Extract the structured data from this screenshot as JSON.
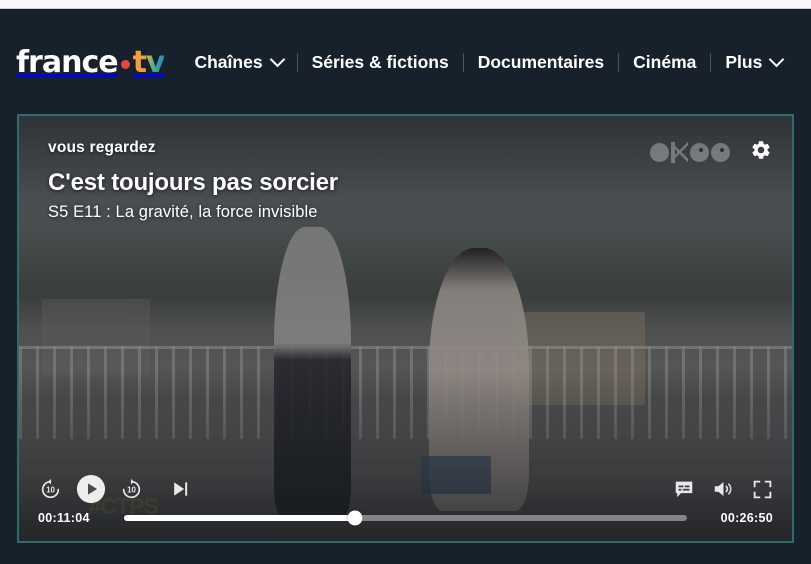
{
  "browser": {
    "bookmarks": [
      "",
      "",
      "",
      "",
      "",
      "",
      "",
      ""
    ]
  },
  "header": {
    "logo": {
      "word": "france",
      "dot_icon": "red-dot",
      "t": "t",
      "v": "v",
      "alt": "france.tv"
    },
    "nav": [
      {
        "label": "Chaînes",
        "has_chevron": true
      },
      {
        "label": "Séries & fictions",
        "has_chevron": false
      },
      {
        "label": "Documentaires",
        "has_chevron": false
      },
      {
        "label": "Cinéma",
        "has_chevron": false
      },
      {
        "label": "Plus",
        "has_chevron": true
      }
    ]
  },
  "player": {
    "kicker": "vous regardez",
    "title": "C'est toujours pas sorcier",
    "episode": "S5 E11 : La gravité, la force invisible",
    "watermark": "okoo",
    "scene_mark": "#CTPS",
    "settings_label": "Paramètres",
    "controls": {
      "rewind_label": "10",
      "play_label": "Lecture",
      "forward_label": "10",
      "next_label": "Épisode suivant",
      "subtitles_label": "Sous-titres",
      "volume_label": "Volume",
      "fullscreen_label": "Plein écran"
    },
    "progress": {
      "current_time": "00:11:04",
      "duration": "00:26:50",
      "percent": 41
    }
  },
  "colors": {
    "page_bg": "#17212b",
    "accent_red": "#e8433c",
    "accent_orange": "#f2a03d",
    "accent_teal": "#3aa6a0",
    "focus_border": "#2d6d69"
  }
}
